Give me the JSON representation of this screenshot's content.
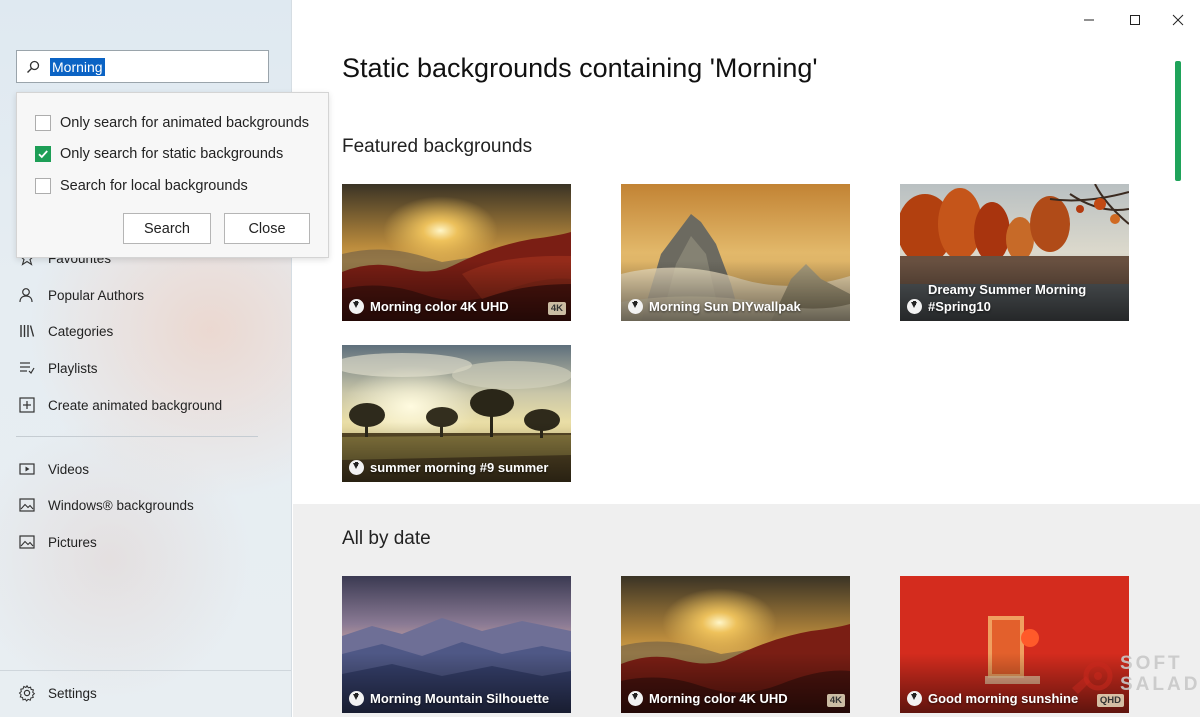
{
  "search": {
    "value": "Morning"
  },
  "popup": {
    "options": [
      {
        "label": "Only search for animated backgrounds",
        "checked": false
      },
      {
        "label": "Only search for static backgrounds",
        "checked": true
      },
      {
        "label": "Search for local backgrounds",
        "checked": false
      }
    ],
    "search_label": "Search",
    "close_label": "Close"
  },
  "nav": {
    "favourites": "Favourites",
    "popular_authors": "Popular Authors",
    "categories": "Categories",
    "playlists": "Playlists",
    "create": "Create animated background",
    "videos": "Videos",
    "windows_backgrounds": "Windows® backgrounds",
    "pictures": "Pictures",
    "settings": "Settings"
  },
  "main": {
    "title": "Static backgrounds containing 'Morning'",
    "featured_title": "Featured backgrounds",
    "all_title": "All by date",
    "featured": [
      {
        "label": "Morning color 4K UHD",
        "badge": "4K",
        "scene": "sunset-hills"
      },
      {
        "label": "Morning Sun DIYwallpak",
        "badge": "",
        "scene": "misty-mountains"
      },
      {
        "label": "Dreamy Summer Morning #Spring10",
        "badge": "",
        "scene": "autumn-lake"
      },
      {
        "label": "summer morning #9 summer",
        "badge": "",
        "scene": "savanna"
      }
    ],
    "all": [
      {
        "label": "Morning Mountain Silhouette",
        "badge": "",
        "scene": "blue-mountains"
      },
      {
        "label": "Morning color 4K UHD",
        "badge": "4K",
        "scene": "sunset-hills"
      },
      {
        "label": "Good morning sunshine",
        "badge": "QHD",
        "scene": "red-abstract"
      }
    ]
  },
  "watermark": {
    "line1": "SOFT",
    "line2": "SALAD"
  }
}
